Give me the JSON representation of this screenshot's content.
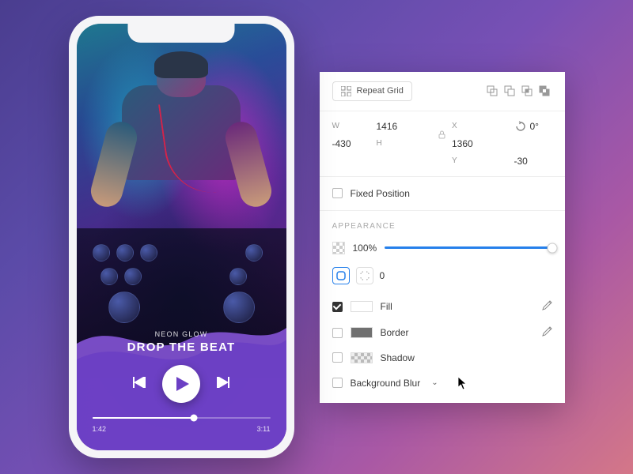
{
  "phone": {
    "artist": "NEON GLOW",
    "track": "DROP THE BEAT",
    "elapsed": "1:42",
    "total": "3:11"
  },
  "panel": {
    "repeat_grid": "Repeat Grid",
    "dims": {
      "w_label": "W",
      "w": "1416",
      "h_label": "H",
      "h": "1360",
      "x_label": "X",
      "x": "-430",
      "y_label": "Y",
      "y": "-30",
      "rotation": "0°"
    },
    "fixed_position": "Fixed Position",
    "appearance_title": "APPEARANCE",
    "opacity": "100%",
    "corner_radius": "0",
    "fill": "Fill",
    "border": "Border",
    "shadow": "Shadow",
    "bg_blur": "Background Blur"
  }
}
